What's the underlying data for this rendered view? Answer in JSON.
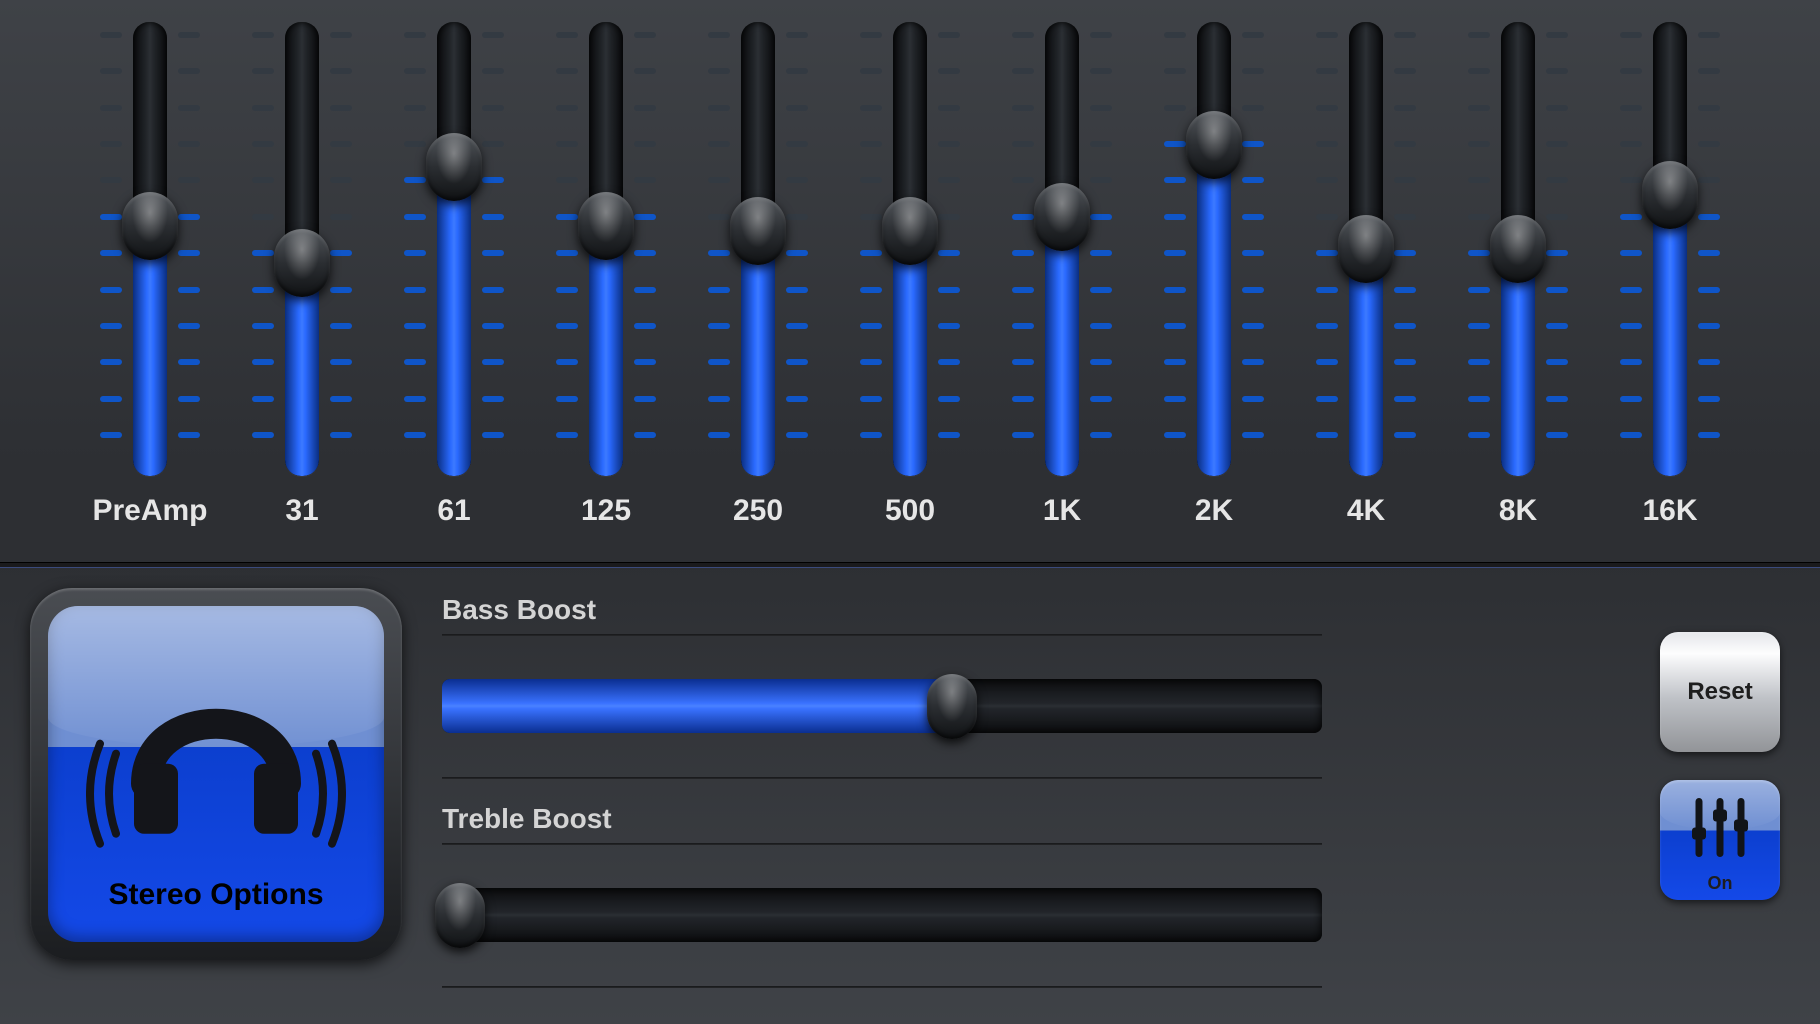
{
  "colors": {
    "accent": "#1e5aff",
    "track_dark": "#16181b"
  },
  "equalizer": {
    "bands": [
      {
        "label": "PreAmp",
        "value": 55
      },
      {
        "label": "31",
        "value": 47
      },
      {
        "label": "61",
        "value": 68
      },
      {
        "label": "125",
        "value": 55
      },
      {
        "label": "250",
        "value": 54
      },
      {
        "label": "500",
        "value": 54
      },
      {
        "label": "1K",
        "value": 57
      },
      {
        "label": "2K",
        "value": 73
      },
      {
        "label": "4K",
        "value": 50
      },
      {
        "label": "8K",
        "value": 50
      },
      {
        "label": "16K",
        "value": 62
      }
    ],
    "tick_count": 12
  },
  "boosts": {
    "bass": {
      "label": "Bass Boost",
      "value": 58
    },
    "treble": {
      "label": "Treble Boost",
      "value": 2
    }
  },
  "buttons": {
    "stereo": {
      "label": "Stereo Options"
    },
    "reset": {
      "label": "Reset"
    },
    "power": {
      "label": "On"
    }
  }
}
